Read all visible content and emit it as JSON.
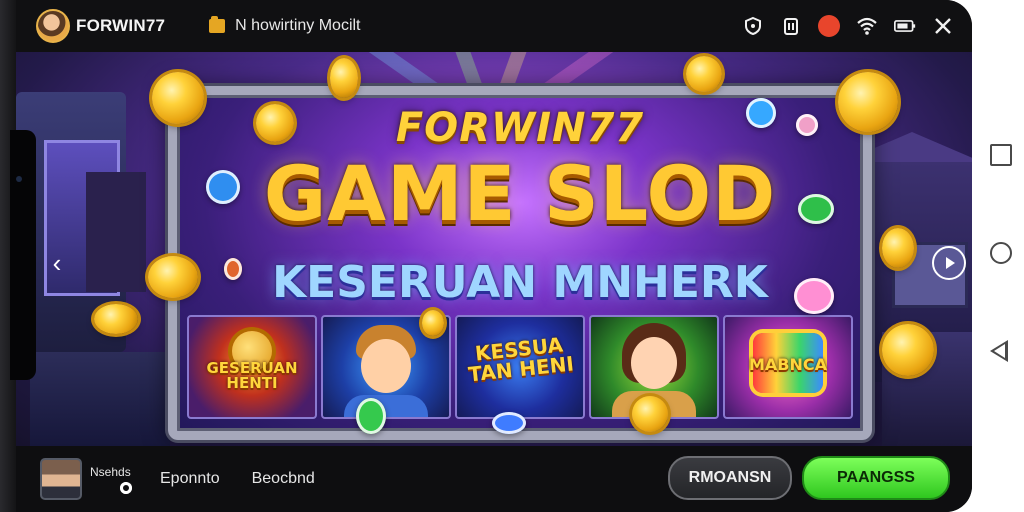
{
  "app": {
    "brand_name": "FORWIN77",
    "tab_title": "N howirtiny Mocilt"
  },
  "topbar_icons": [
    "shield-icon",
    "clipboard-icon",
    "record-icon",
    "wifi-icon",
    "battery-icon",
    "close-icon"
  ],
  "banner": {
    "logo_text": "FORWIN77",
    "headline": "GAME SLOD",
    "tagline": "KESERUAN MNHERK",
    "cards": [
      {
        "label": "GESERUAN HENTI"
      },
      {
        "label": ""
      },
      {
        "label": "KESSUA TAN HENI"
      },
      {
        "label": ""
      },
      {
        "label": "MABNCA"
      }
    ],
    "left_arrow": "‹",
    "right_arrow": "›"
  },
  "bottombar": {
    "user_name": "Nsehds",
    "link_1": "Eponnto",
    "link_2": "Beocbnd",
    "secondary_button": "RMOANSN",
    "primary_button": "PAANGSS"
  },
  "colors": {
    "primary_button": "#3ad52a",
    "headline_gold": "#ffc933",
    "tagline_blue": "#9fd6ff",
    "record_red": "#e8452c"
  }
}
